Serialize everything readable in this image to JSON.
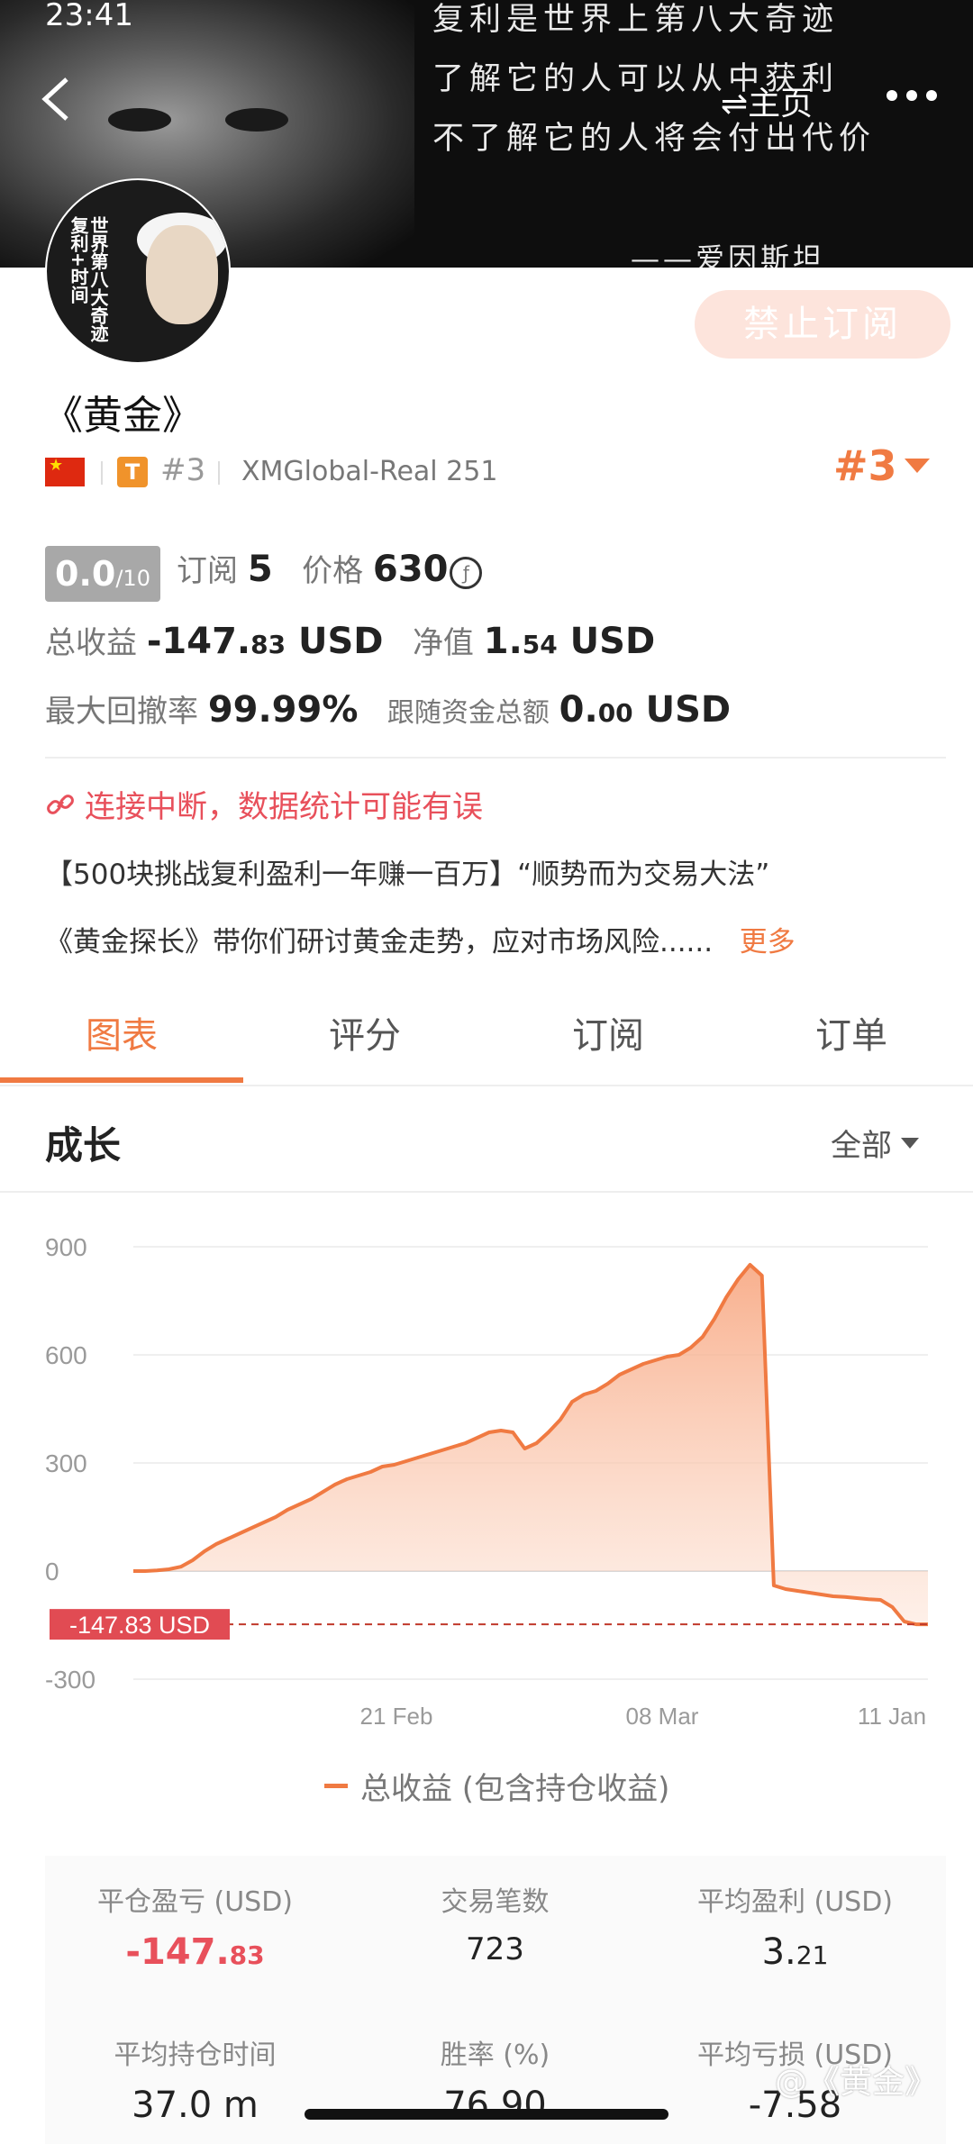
{
  "status": {
    "time": "23:41"
  },
  "banner": {
    "quote_lines": [
      "复利是世界上第八大奇迹",
      "了解它的人可以从中获利",
      "不了解它的人将会付出代价"
    ],
    "author": "——爱因斯坦",
    "avatar_text": "世界第八大奇迹 复利+时间"
  },
  "nav": {
    "home_label": "⇌主页",
    "back_icon": "back-chevron-icon",
    "more_icon": "more-dots-icon"
  },
  "profile": {
    "subscribe_label": "禁止订阅",
    "title": "《黄金》",
    "rank_small": "#3",
    "t_badge": "T",
    "server": "XMGlobal-Real 251",
    "rank_big": "#3"
  },
  "metrics": {
    "score": "0.0",
    "score_max": "/10",
    "subscribe_label": "订阅",
    "subscribe_count": "5",
    "price_label": "价格",
    "price_value": "630",
    "coin_symbol": "ƒ",
    "total_profit_label": "总收益",
    "total_profit_main": "-147.",
    "total_profit_dec": "83",
    "total_profit_unit": " USD",
    "equity_label": "净值",
    "equity_main": "1.",
    "equity_dec": "54",
    "equity_unit": " USD",
    "drawdown_label": "最大回撤率",
    "drawdown_value": "99.99%",
    "follow_label": "跟随资金总额",
    "follow_main": "0.",
    "follow_dec": "00",
    "follow_unit": " USD"
  },
  "warning": "连接中断，数据统计可能有误",
  "description": {
    "line1": "【500块挑战复利盈利一年赚一百万】“顺势而为交易大法”",
    "line2": "《黄金探长》带你们研讨黄金走势，应对市场风险......",
    "more": "更多"
  },
  "tabs": [
    {
      "label": "图表",
      "active": true
    },
    {
      "label": "评分",
      "active": false
    },
    {
      "label": "订阅",
      "active": false
    },
    {
      "label": "订单",
      "active": false
    }
  ],
  "growth": {
    "title": "成长",
    "range": "全部",
    "current_label": "-147.83 USD",
    "legend": "总收益 (包含持仓收益)"
  },
  "chart_data": {
    "type": "area",
    "ylim": [
      -300,
      900
    ],
    "y_ticks": [
      900,
      600,
      300,
      0,
      -300
    ],
    "x_tick_labels": [
      "21 Feb",
      "08 Mar",
      "11 Jan"
    ],
    "color": "#f07a42",
    "series": [
      {
        "values": [
          0,
          0,
          2,
          5,
          12,
          30,
          55,
          75,
          90,
          105,
          120,
          135,
          150,
          170,
          185,
          200,
          220,
          240,
          255,
          265,
          275,
          290,
          295,
          305,
          315,
          325,
          335,
          345,
          355,
          370,
          385,
          390,
          385,
          340,
          355,
          385,
          420,
          470,
          490,
          500,
          520,
          545,
          560,
          575,
          585,
          595,
          600,
          620,
          650,
          700,
          760,
          810,
          850,
          820,
          -40,
          -50,
          -55,
          -60,
          -65,
          -70,
          -72,
          -75,
          -78,
          -80,
          -100,
          -140,
          -147.83,
          -147.83
        ]
      }
    ],
    "reference_line": -147.83
  },
  "stats": [
    {
      "label": "平仓盈亏 (USD)",
      "main": "-147.",
      "dec": "83",
      "negative": true
    },
    {
      "label": "交易笔数",
      "main": "723",
      "dec": "",
      "negative": false
    },
    {
      "label": "平均盈利 (USD)",
      "main": "3.",
      "dec": "21",
      "negative": false
    },
    {
      "label": "平均持仓时间",
      "main": "37.0 m",
      "dec": "",
      "negative": false
    },
    {
      "label": "胜率 (%)",
      "main": "76.90",
      "dec": "",
      "negative": false
    },
    {
      "label": "平均亏损 (USD)",
      "main": "-7.58",
      "dec": "",
      "negative": false
    }
  ],
  "watermark": "@《黄金》"
}
